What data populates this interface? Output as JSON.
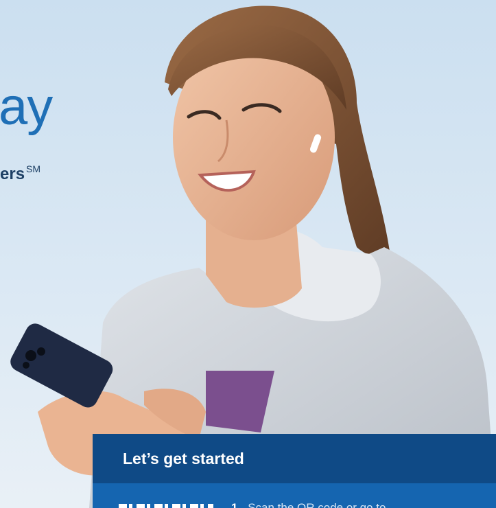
{
  "hero": {
    "headline_fragment": "ay",
    "subhead_fragment": "ers",
    "subhead_superscript": "SM"
  },
  "card": {
    "title": "Let’s get started",
    "step_number": "1.",
    "step_text": "Scan the QR code or go to"
  },
  "colors": {
    "headline": "#1f6fb6",
    "card_header": "#0f4a86",
    "card_body": "#1565b0"
  },
  "image": {
    "subject": "smiling woman with earbud holding a smartphone"
  }
}
